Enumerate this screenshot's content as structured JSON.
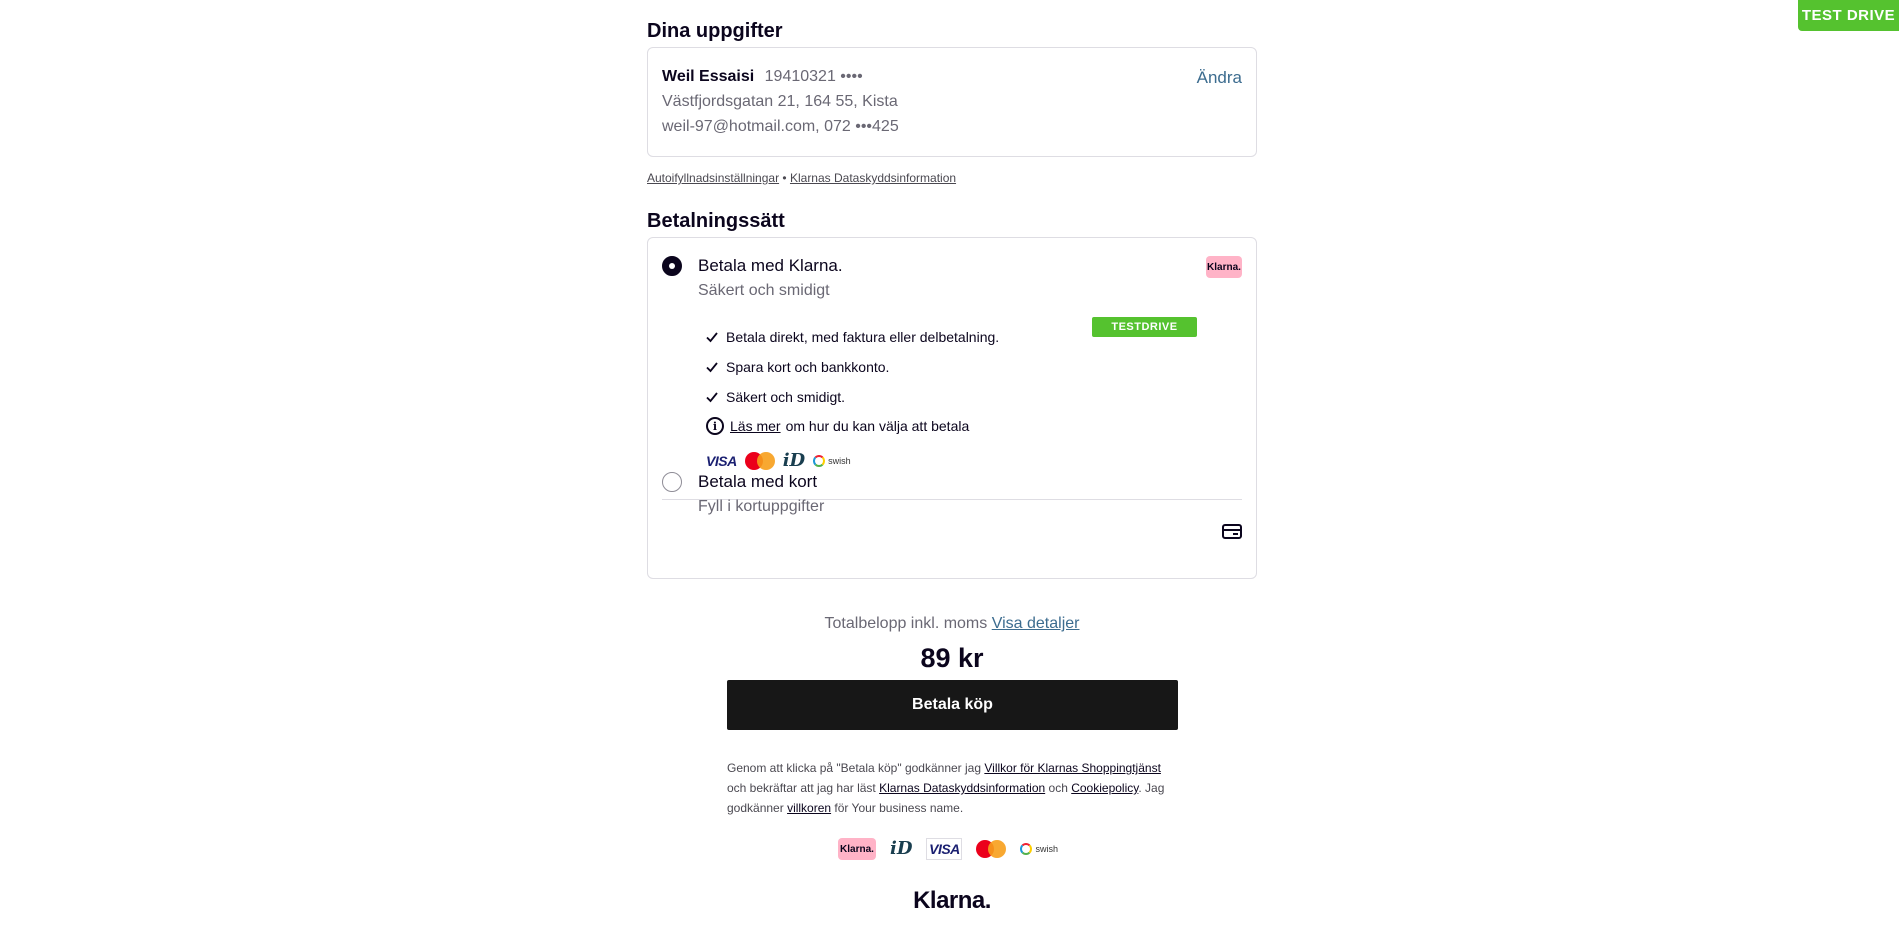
{
  "test_drive_badge": "TEST DRIVE",
  "details": {
    "heading": "Dina uppgifter",
    "name": "Weil Essaisi",
    "ssn": "19410321 ••••",
    "address": "Västfjordsgatan 21, 164 55, Kista",
    "contact": "weil-97@hotmail.com, 072 •••425",
    "change_label": "Ändra"
  },
  "links": {
    "autofill": "Autoifyllnadsinställningar",
    "separator": "•",
    "privacy": "Klarnas Dataskyddsinformation"
  },
  "payment": {
    "heading": "Betalningssätt",
    "klarna_option": {
      "title": "Betala med Klarna.",
      "subtitle": "Säkert och smidigt",
      "badge": "Klarna.",
      "testdrive_label": "TESTDRIVE",
      "selected": true,
      "bullets": [
        "Betala direkt, med faktura eller delbetalning.",
        "Spara kort och bankkonto.",
        "Säkert och smidigt."
      ],
      "info_icon": "i",
      "info_link": "Läs mer",
      "info_text": "om hur du kan välja att betala",
      "logos": {
        "visa": "VISA",
        "bankid": "iD",
        "swish": "swish"
      }
    },
    "card_option": {
      "title": "Betala med kort",
      "subtitle": "Fyll i kortuppgifter",
      "selected": false,
      "icon": "credit-card-icon"
    }
  },
  "total": {
    "label": "Totalbelopp inkl. moms",
    "details_link": "Visa detaljer",
    "amount": "89 kr"
  },
  "pay_button": "Betala köp",
  "legal": {
    "part1": "Genom att klicka på \"Betala köp\" godkänner jag",
    "link1": "Villkor för Klarnas Shoppingtjänst",
    "part2": "och bekräftar att jag har läst",
    "link2": "Klarnas Dataskyddsinformation",
    "part3": "och",
    "link3": "Cookiepolicy",
    "part4": ". Jag godkänner",
    "link4": "villkoren",
    "part5": "för Your business name."
  },
  "footer": {
    "klarna_badge": "Klarna.",
    "bankid": "iD",
    "visa": "VISA",
    "swish": "swish",
    "wordmark": "Klarna."
  },
  "colors": {
    "accent_green": "#55c22f",
    "klarna_pink": "#ffb3c7",
    "link_blue": "#3c6c8f",
    "button_black": "#171717"
  }
}
